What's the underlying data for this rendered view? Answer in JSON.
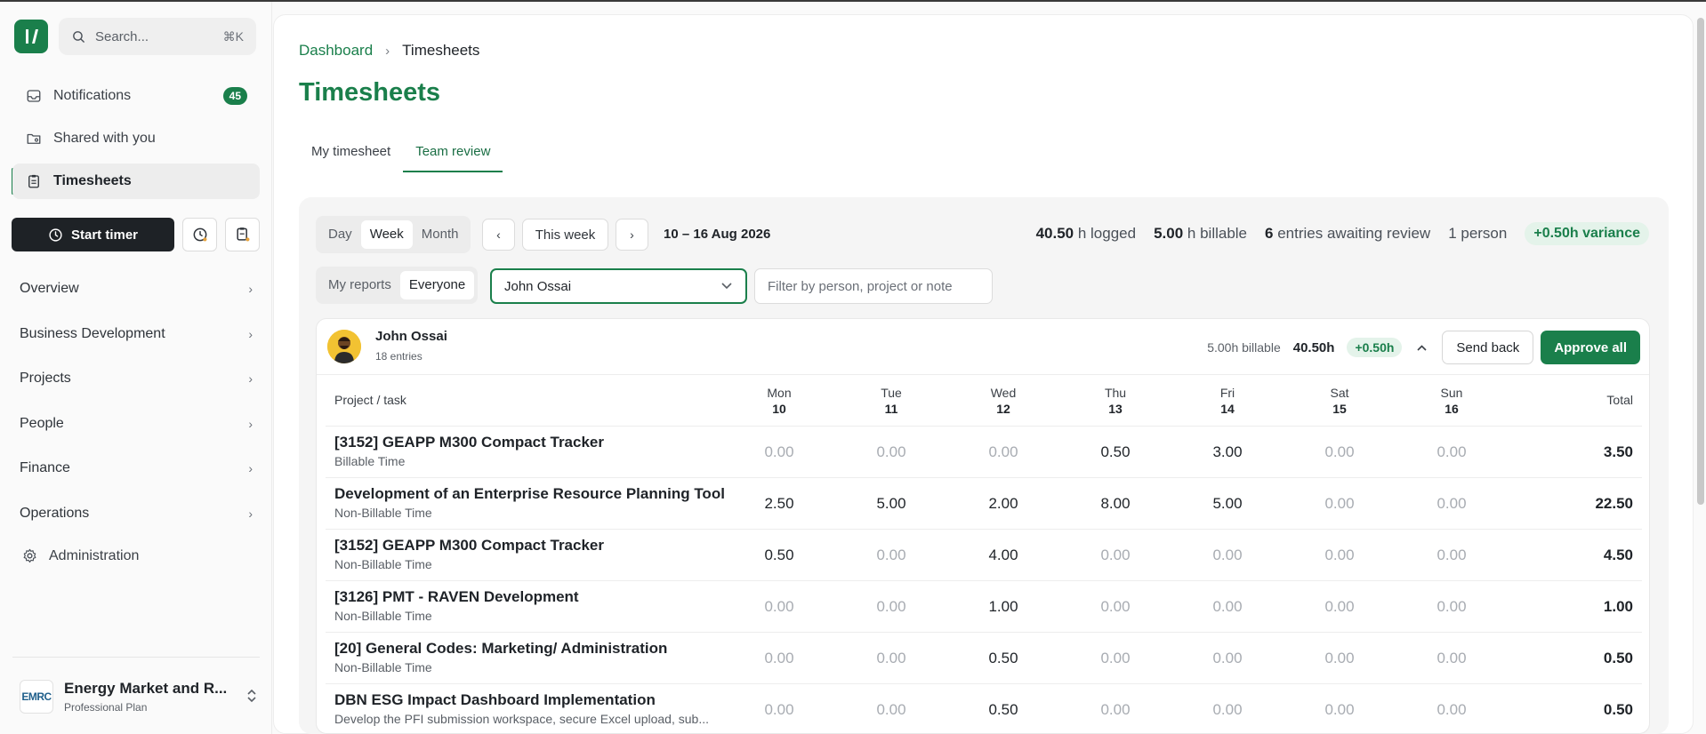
{
  "sidebar": {
    "search_placeholder": "Search...",
    "search_shortcut": "⌘K",
    "nav": [
      {
        "label": "Notifications",
        "badge": "45",
        "icon": "inbox-icon"
      },
      {
        "label": "Shared with you",
        "icon": "shared-folder-icon"
      },
      {
        "label": "Timesheets",
        "icon": "clipboard-icon",
        "active": true
      }
    ],
    "start_timer_label": "Start timer",
    "sections": [
      "Overview",
      "Business Development",
      "Projects",
      "People",
      "Finance",
      "Operations"
    ],
    "admin_label": "Administration",
    "org": {
      "logo_text": "EMRC",
      "name": "Energy Market and R...",
      "plan": "Professional Plan"
    }
  },
  "breadcrumb": {
    "root": "Dashboard",
    "separator": "›",
    "current": "Timesheets"
  },
  "page_title": "Timesheets",
  "tabs": [
    {
      "label": "My timesheet",
      "active": false
    },
    {
      "label": "Team review",
      "active": true
    }
  ],
  "toolbar": {
    "period": {
      "options": [
        "Day",
        "Week",
        "Month"
      ],
      "selected": "Week"
    },
    "this_week_label": "This week",
    "date_range": "10 – 16 Aug 2026",
    "scope": {
      "options": [
        "My reports",
        "Everyone"
      ],
      "selected": "Everyone"
    },
    "person_select_value": "John Ossai",
    "filter_placeholder": "Filter by person, project or note"
  },
  "stats": {
    "logged_value": "40.50",
    "logged_label": "h logged",
    "billable_value": "5.00",
    "billable_label": "h billable",
    "entries_value": "6",
    "entries_label": "entries awaiting review",
    "people": "1 person",
    "variance": "+0.50h variance"
  },
  "person": {
    "name": "John Ossai",
    "entries": "18 entries",
    "billable": "5.00h billable",
    "hours": "40.50h",
    "variance": "+0.50h",
    "send_back_label": "Send back",
    "approve_label": "Approve all"
  },
  "table": {
    "task_header": "Project / task",
    "total_header": "Total",
    "days": [
      {
        "day": "Mon",
        "date": "10"
      },
      {
        "day": "Tue",
        "date": "11"
      },
      {
        "day": "Wed",
        "date": "12"
      },
      {
        "day": "Thu",
        "date": "13"
      },
      {
        "day": "Fri",
        "date": "14"
      },
      {
        "day": "Sat",
        "date": "15"
      },
      {
        "day": "Sun",
        "date": "16"
      }
    ],
    "rows": [
      {
        "name": "[3152] GEAPP M300 Compact Tracker",
        "type": "Billable Time",
        "hours": [
          "0.00",
          "0.00",
          "0.00",
          "0.50",
          "3.00",
          "0.00",
          "0.00"
        ],
        "total": "3.50"
      },
      {
        "name": "Development of an Enterprise Resource Planning Tool",
        "type": "Non-Billable Time",
        "hours": [
          "2.50",
          "5.00",
          "2.00",
          "8.00",
          "5.00",
          "0.00",
          "0.00"
        ],
        "total": "22.50"
      },
      {
        "name": "[3152] GEAPP M300 Compact Tracker",
        "type": "Non-Billable Time",
        "hours": [
          "0.50",
          "0.00",
          "4.00",
          "0.00",
          "0.00",
          "0.00",
          "0.00"
        ],
        "total": "4.50"
      },
      {
        "name": "[3126] PMT - RAVEN Development",
        "type": "Non-Billable Time",
        "hours": [
          "0.00",
          "0.00",
          "1.00",
          "0.00",
          "0.00",
          "0.00",
          "0.00"
        ],
        "total": "1.00"
      },
      {
        "name": "[20] General Codes: Marketing/ Administration",
        "type": "Non-Billable Time",
        "hours": [
          "0.00",
          "0.00",
          "0.50",
          "0.00",
          "0.00",
          "0.00",
          "0.00"
        ],
        "total": "0.50"
      },
      {
        "name": "DBN ESG Impact Dashboard Implementation",
        "type": "Develop the PFI submission workspace, secure Excel upload, sub...",
        "hours": [
          "0.00",
          "0.00",
          "0.50",
          "0.00",
          "0.00",
          "0.00",
          "0.00"
        ],
        "total": "0.50"
      }
    ]
  },
  "colors": {
    "accent": "#1a7f4b",
    "variance_bg": "#e4f3ea",
    "zero": "#a8acb2"
  }
}
